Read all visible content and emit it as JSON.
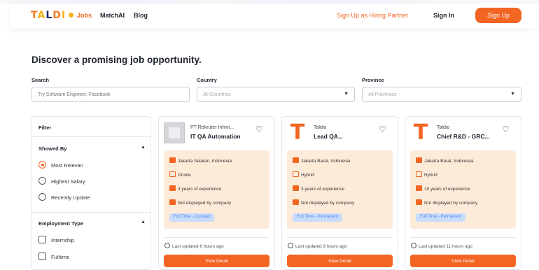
{
  "nav": {
    "logo": {
      "t": "T",
      "a": "A",
      "l": "L",
      "d": "D",
      "o": "I"
    },
    "links": [
      "Jobs",
      "MatchAI",
      "Blog"
    ],
    "hiring_partner": "Sign Up as Hiring Partner",
    "sign_in": "Sign In",
    "sign_up": "Sign Up"
  },
  "page": {
    "title": "Discover a promising job opportunity.",
    "search_label": "Search",
    "search_placeholder": "Try Software Engineer, Facebook",
    "country_label": "Country",
    "country_value": "All Countries",
    "province_label": "Province",
    "province_value": "All Provinces"
  },
  "filter": {
    "title": "Filter",
    "showed_by": {
      "title": "Showed By",
      "options": [
        "Most Relevan",
        "Highest Salary",
        "Recently Update"
      ],
      "selected": "Most Relevan"
    },
    "employment_type": {
      "title": "Employment Type",
      "options": [
        "Internship",
        "Fulltime"
      ]
    }
  },
  "jobs": [
    {
      "company": "PT Rekruter Infinit...",
      "title": "IT QA Automation",
      "location": "Jakarta Selatan, Indonesia",
      "work_type": "Onsite",
      "experience": "3 years of experience",
      "salary": "Not displayed by company",
      "employment": "Full Time - Contract",
      "updated": "Last updated 6 hours ago",
      "button": "View Detail"
    },
    {
      "company": "Taldio",
      "title": "Lead QA...",
      "location": "Jakarta Barat, Indonesia",
      "work_type": "Hybrid",
      "experience": "3 years of experience",
      "salary": "Not displayed by company",
      "employment": "Full Time - Permanent",
      "updated": "Last updated 9 hours ago",
      "button": "View Detail"
    },
    {
      "company": "Taldio",
      "title": "Chief R&D - GRC...",
      "location": "Jakarta Barat, Indonesia",
      "work_type": "Hybrid",
      "experience": "10 years of experience",
      "salary": "Not displayed by company",
      "employment": "Full Time - Permanent",
      "updated": "Last updated 11 hours ago",
      "button": "View Detail"
    }
  ],
  "colors": {
    "accent": "#f26522",
    "tag_bg": "#c9dcfb",
    "tag_text": "#4f86e8",
    "info_bg": "#fdebd9"
  },
  "icons": {
    "heart": "heart-icon",
    "chevron": "chevron-down-icon",
    "clock": "clock-icon",
    "building": "building-icon",
    "laptop": "laptop-icon",
    "briefcase": "briefcase-icon",
    "money": "money-icon"
  }
}
